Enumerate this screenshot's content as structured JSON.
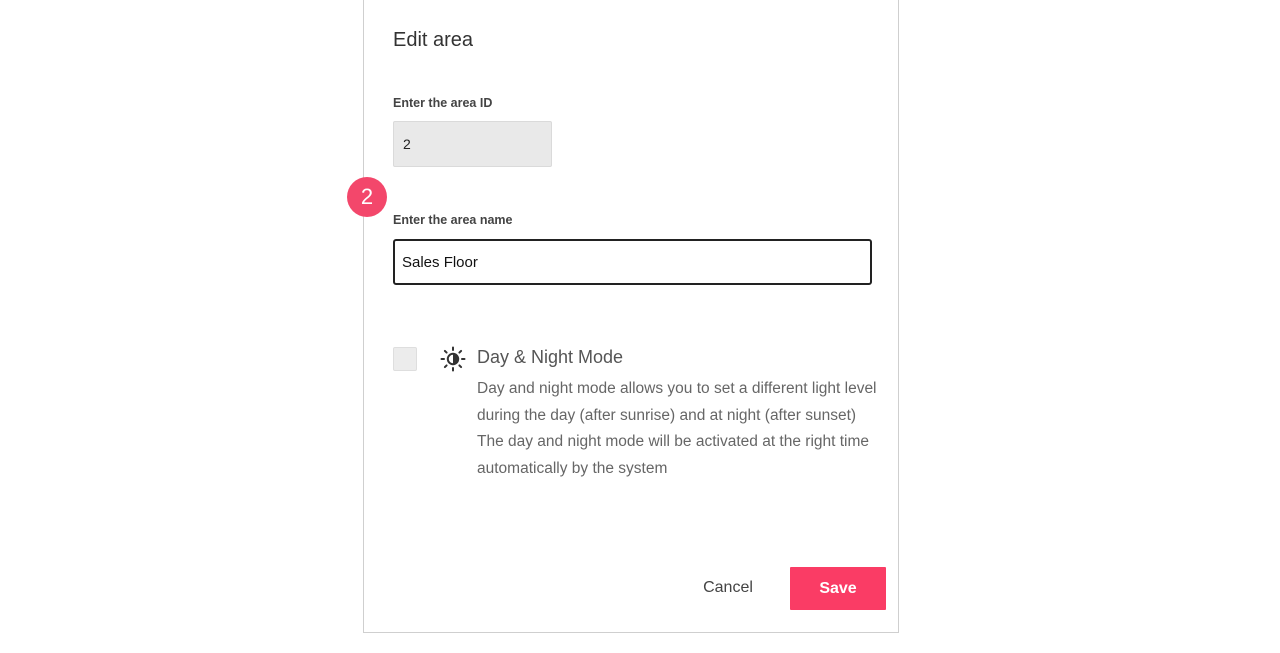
{
  "dialog": {
    "title": "Edit area",
    "area_id": {
      "label": "Enter the area ID",
      "value": "2"
    },
    "area_name": {
      "label": "Enter the area name",
      "value": "Sales Floor"
    },
    "step_badge": "2",
    "day_night": {
      "icon": "sun-moon-icon",
      "checked": false,
      "title": "Day & Night Mode",
      "description_1": "Day and night mode allows you to set a different light level during the day (after sunrise) and at night (after sunset)",
      "description_2": "The day and night mode will be activated at the right time automatically by the system"
    },
    "buttons": {
      "cancel": "Cancel",
      "save": "Save"
    }
  },
  "colors": {
    "accent": "#fa3c65",
    "badge": "#f3476b"
  }
}
